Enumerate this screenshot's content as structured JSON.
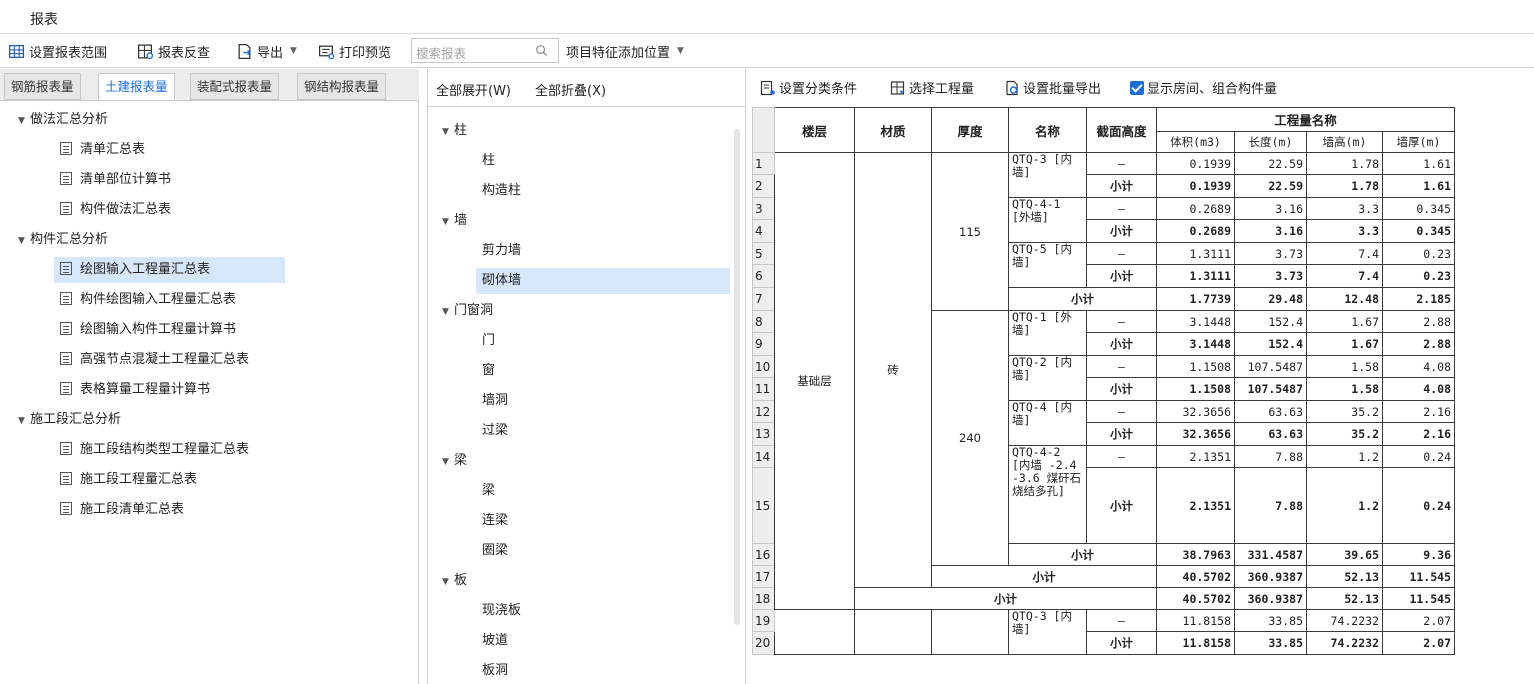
{
  "app": {
    "title": "报表"
  },
  "toolbar": {
    "set_range": "设置报表范围",
    "report_check": "报表反查",
    "export": "导出",
    "print_preview": "打印预览",
    "search_placeholder": "搜索报表",
    "add_position": "项目特征添加位置"
  },
  "tabs": [
    {
      "label": "钢筋报表量",
      "active": false
    },
    {
      "label": "土建报表量",
      "active": true
    },
    {
      "label": "装配式报表量",
      "active": false
    },
    {
      "label": "钢结构报表量",
      "active": false
    }
  ],
  "tree": {
    "group1": {
      "label": "做法汇总分析",
      "items": [
        "清单汇总表",
        "清单部位计算书",
        "构件做法汇总表"
      ]
    },
    "group2": {
      "label": "构件汇总分析",
      "items": [
        "绘图输入工程量汇总表",
        "构件绘图输入工程量汇总表",
        "绘图输入构件工程量计算书",
        "高强节点混凝土工程量汇总表",
        "表格算量工程量计算书"
      ],
      "selected": "绘图输入工程量汇总表"
    },
    "group3": {
      "label": "施工段汇总分析",
      "items": [
        "施工段结构类型工程量汇总表",
        "施工段工程量汇总表",
        "施工段清单汇总表"
      ]
    }
  },
  "middle": {
    "expand_all": "全部展开(W)",
    "collapse_all": "全部折叠(X)",
    "groups": [
      {
        "label": "柱",
        "items": [
          "柱",
          "构造柱"
        ]
      },
      {
        "label": "墙",
        "items": [
          "剪力墙",
          "砌体墙"
        ]
      },
      {
        "label": "门窗洞",
        "items": [
          "门",
          "窗",
          "墙洞",
          "过梁"
        ]
      },
      {
        "label": "梁",
        "items": [
          "梁",
          "连梁",
          "圈梁"
        ]
      },
      {
        "label": "板",
        "items": [
          "现浇板",
          "坡道",
          "板洞"
        ]
      }
    ],
    "selected": "砌体墙"
  },
  "right_toolbar": {
    "set_category": "设置分类条件",
    "select_quantity": "选择工程量",
    "batch_export": "设置批量导出",
    "show_rooms": "显示房间、组合构件量",
    "show_rooms_checked": true
  },
  "table": {
    "headers": {
      "floor": "楼层",
      "material": "材质",
      "thickness": "厚度",
      "name": "名称",
      "section_height": "截面高度",
      "quantity_name": "工程量名称",
      "volume": "体积(m3)",
      "length": "长度(m)",
      "wall_height": "墙高(m)",
      "wall_thickness": "墙厚(m)"
    },
    "floor_label": "基础层",
    "material_label": "砖",
    "thickness_115": "115",
    "thickness_240": "240",
    "dash": "—",
    "subtotal": "小计",
    "row_numbers": [
      "1",
      "2",
      "3",
      "4",
      "5",
      "6",
      "7",
      "8",
      "9",
      "10",
      "11",
      "12",
      "13",
      "14",
      "15",
      "16",
      "17",
      "18",
      "19",
      "20"
    ],
    "names": {
      "qtq3": "QTQ-3 [内墙]",
      "qtq41": "QTQ-4-1 [外墙]",
      "qtq5": "QTQ-5 [内墙]",
      "qtq1": "QTQ-1 [外墙]",
      "qtq2": "QTQ-2 [内墙]",
      "qtq4": "QTQ-4 [内墙]",
      "qtq42": "QTQ-4-2 [内墙 -2.4 -3.6 煤矸石烧结多孔]",
      "qtq3b": "QTQ-3 [内墙]"
    },
    "rows": [
      [
        "0.1939",
        "22.59",
        "1.78",
        "1.61"
      ],
      [
        "0.1939",
        "22.59",
        "1.78",
        "1.61"
      ],
      [
        "0.2689",
        "3.16",
        "3.3",
        "0.345"
      ],
      [
        "0.2689",
        "3.16",
        "3.3",
        "0.345"
      ],
      [
        "1.3111",
        "3.73",
        "7.4",
        "0.23"
      ],
      [
        "1.3111",
        "3.73",
        "7.4",
        "0.23"
      ],
      [
        "1.7739",
        "29.48",
        "12.48",
        "2.185"
      ],
      [
        "3.1448",
        "152.4",
        "1.67",
        "2.88"
      ],
      [
        "3.1448",
        "152.4",
        "1.67",
        "2.88"
      ],
      [
        "1.1508",
        "107.5487",
        "1.58",
        "4.08"
      ],
      [
        "1.1508",
        "107.5487",
        "1.58",
        "4.08"
      ],
      [
        "32.3656",
        "63.63",
        "35.2",
        "2.16"
      ],
      [
        "32.3656",
        "63.63",
        "35.2",
        "2.16"
      ],
      [
        "2.1351",
        "7.88",
        "1.2",
        "0.24"
      ],
      [
        "2.1351",
        "7.88",
        "1.2",
        "0.24"
      ],
      [
        "38.7963",
        "331.4587",
        "39.65",
        "9.36"
      ],
      [
        "40.5702",
        "360.9387",
        "52.13",
        "11.545"
      ],
      [
        "40.5702",
        "360.9387",
        "52.13",
        "11.545"
      ],
      [
        "11.8158",
        "33.85",
        "74.2232",
        "2.07"
      ],
      [
        "11.8158",
        "33.85",
        "74.2232",
        "2.07"
      ]
    ]
  },
  "colors": {
    "accent": "#1a6ed8",
    "selection": "#d7e7fb"
  }
}
